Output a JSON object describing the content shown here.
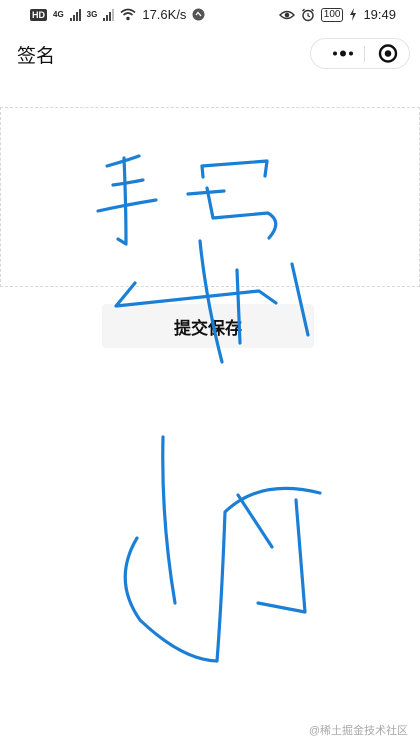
{
  "status_bar": {
    "hd_badge": "HD",
    "network_1": "4G",
    "network_2": "3G",
    "speed": "17.6K/s",
    "battery": "100",
    "time": "19:49"
  },
  "header": {
    "title": "签名"
  },
  "signature": {
    "submit_label": "提交保存",
    "ink_color": "#1b7fd6"
  },
  "watermark": "@稀土掘金技术社区"
}
